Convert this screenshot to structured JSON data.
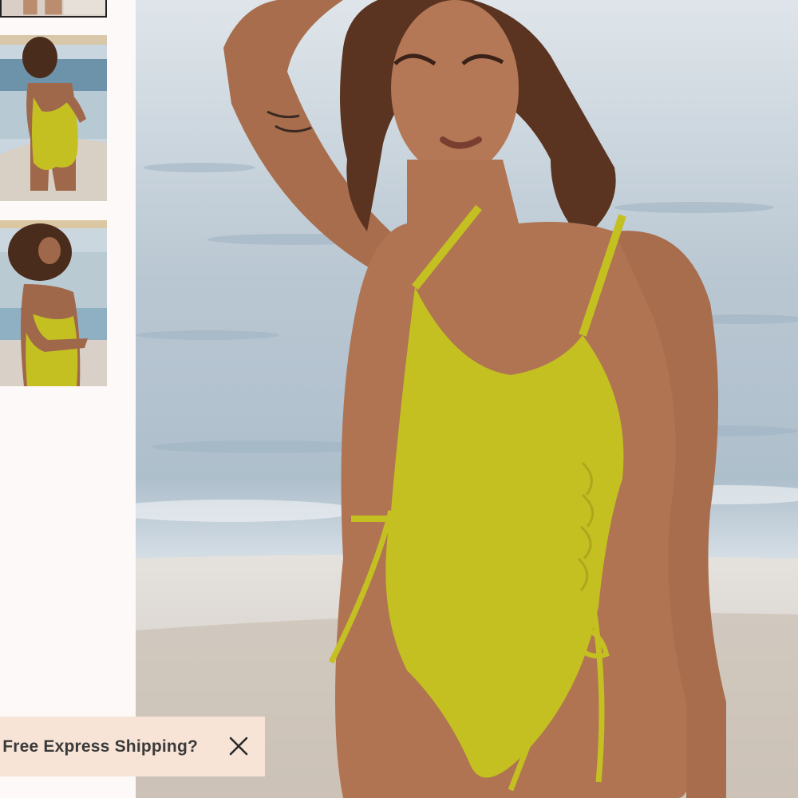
{
  "gallery": {
    "thumbnail_count": 3,
    "active_index": 0,
    "thumbnails": [
      {
        "icon": "product-photo-front-crop"
      },
      {
        "icon": "product-photo-back-view"
      },
      {
        "icon": "product-photo-side-view"
      }
    ],
    "main_image": {
      "icon": "product-photo-model-beach",
      "swimsuit_color": "#c4c022"
    }
  },
  "shipping_banner": {
    "text": "t Free Express Shipping?",
    "close_icon": "close-icon"
  },
  "colors": {
    "background": "#fdf9f8",
    "banner_bg": "#f7e4d6",
    "banner_text": "#3a3a3a",
    "swimsuit": "#c4c022"
  }
}
